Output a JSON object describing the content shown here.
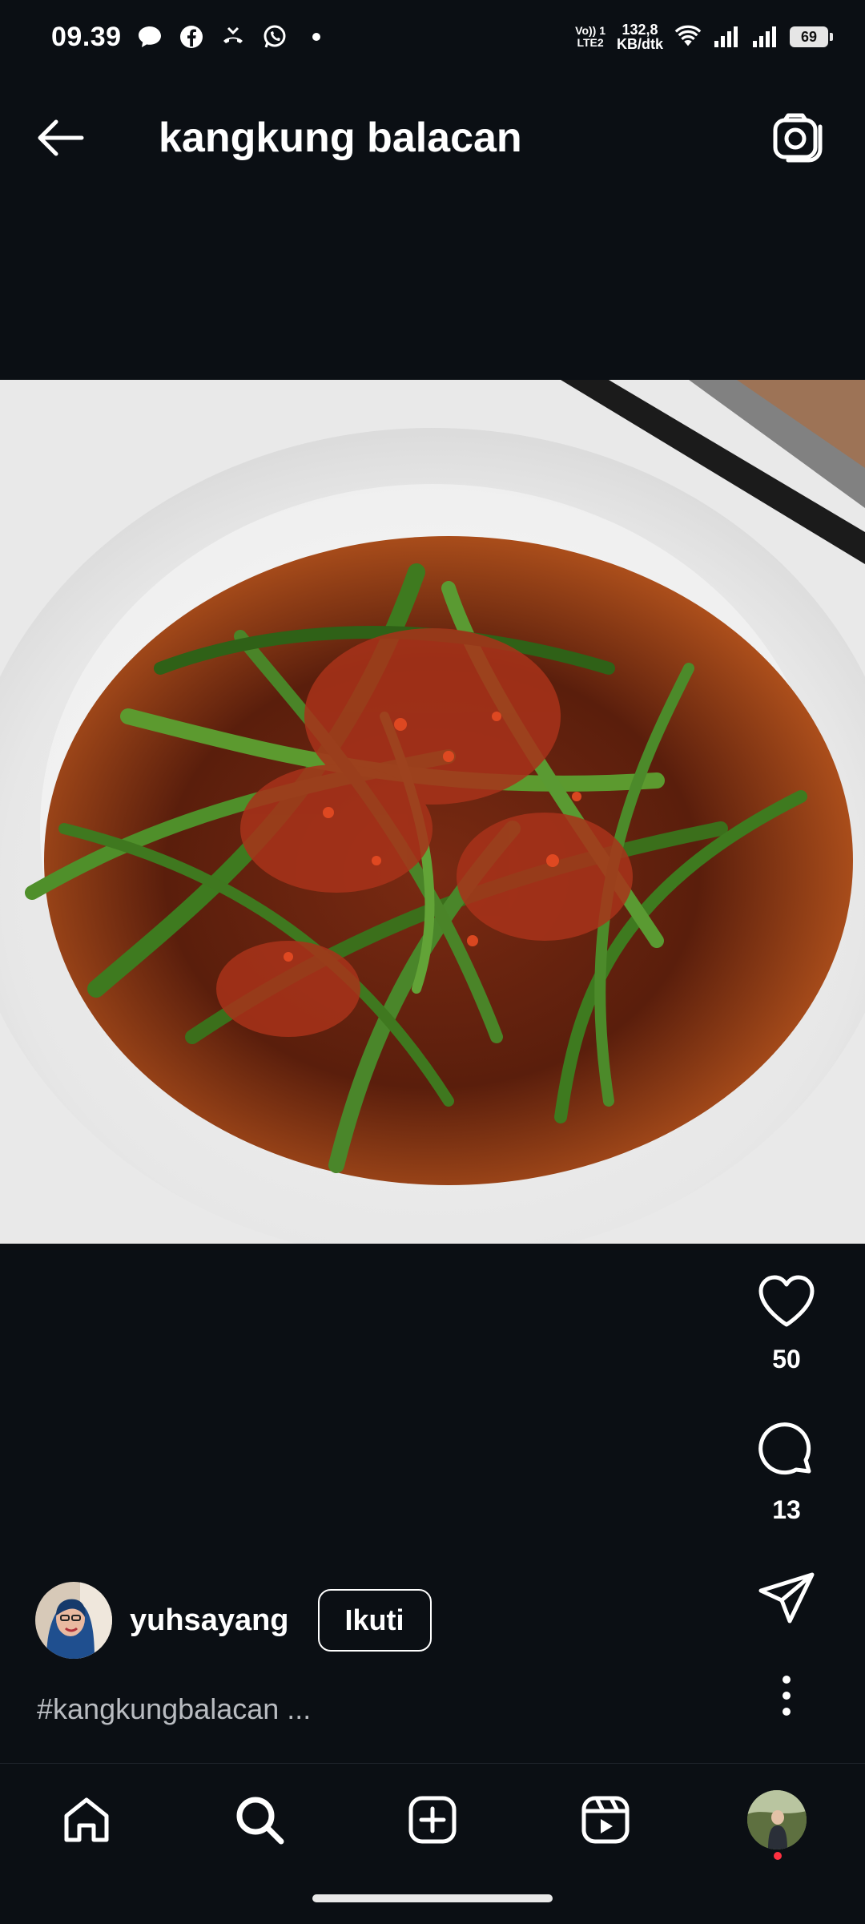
{
  "status_bar": {
    "time": "09.39",
    "network_label_top": "Vo)) 1",
    "network_label_bottom": "LTE2",
    "speed_top": "132,8",
    "speed_bottom": "KB/dtk",
    "battery": "69",
    "icons": [
      "message-icon",
      "facebook-icon",
      "missed-call-icon",
      "whatsapp-icon",
      "dot-icon",
      "wifi-icon",
      "signal-icon",
      "signal-icon",
      "battery-icon"
    ]
  },
  "header": {
    "title": "kangkung balacan"
  },
  "post": {
    "image_alt": "stir-fried water spinach with chili belacan on a white plate",
    "likes": "50",
    "comments": "13",
    "author": {
      "username": "yuhsayang",
      "follow_label": "Ikuti"
    },
    "caption": "#kangkungbalacan ..."
  },
  "bottom_nav": {
    "items": [
      "home-icon",
      "search-icon",
      "create-icon",
      "reels-icon",
      "profile-avatar"
    ]
  },
  "colors": {
    "background": "#0b0f14",
    "notification_dot": "#ff3040",
    "caption": "#b9bcc1"
  }
}
